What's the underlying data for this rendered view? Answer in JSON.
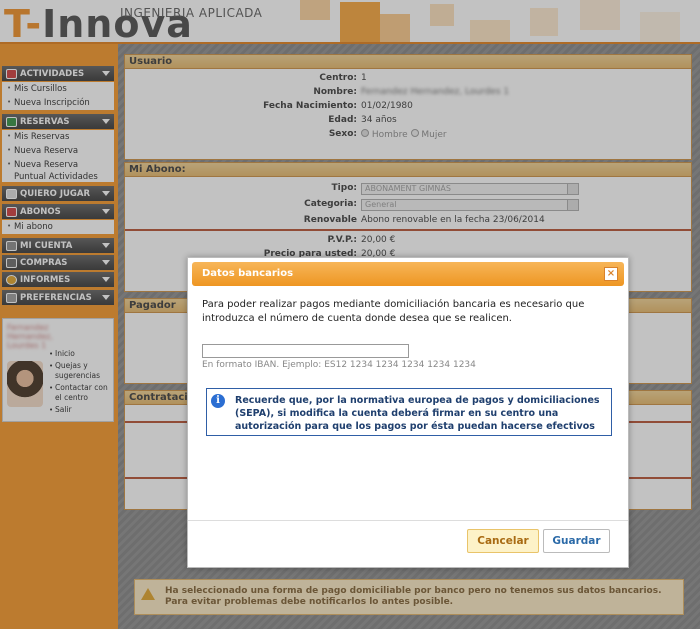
{
  "header": {
    "brand_prefix": "T-",
    "brand_main": "Innova",
    "tagline": "INGENIERIA APLICADA"
  },
  "sidebar": {
    "sections": [
      {
        "label": "ACTIVIDADES",
        "items": [
          "Mis Cursillos",
          "Nueva Inscripción"
        ]
      },
      {
        "label": "RESERVAS",
        "items": [
          "Mis Reservas",
          "Nueva Reserva",
          "Nueva Reserva Puntual Actividades"
        ]
      },
      {
        "label": "QUIERO JUGAR",
        "items": []
      },
      {
        "label": "ABONOS",
        "items": [
          "Mi abono"
        ]
      },
      {
        "label": "MI CUENTA",
        "items": []
      },
      {
        "label": "COMPRAS",
        "items": []
      },
      {
        "label": "INFORMES",
        "items": []
      },
      {
        "label": "PREFERENCIAS",
        "items": []
      }
    ],
    "user_links": [
      "Inicio",
      "Quejas y sugerencias",
      "Contactar con el centro",
      "Salir"
    ]
  },
  "usuario": {
    "title": "Usuario",
    "centro_label": "Centro:",
    "centro": "1",
    "nombre_label": "Nombre:",
    "nombre": "Fernandez Hernandez, Lourdes 1",
    "nac_label": "Fecha Nacimiento:",
    "nac": "01/02/1980",
    "edad_label": "Edad:",
    "edad": "34 años",
    "sexo_label": "Sexo:",
    "sexo_opt1": "Hombre",
    "sexo_opt2": "Mujer"
  },
  "abono": {
    "title": "Mi Abono:",
    "tipo_label": "Tipo:",
    "tipo": "ABONAMENT GIMNÀS",
    "categoria_label": "Categoria:",
    "categoria": "General",
    "renovable_label": "Renovable",
    "renovable": "Abono renovable en la fecha 23/06/2014",
    "pvp_label": "P.V.P.:",
    "pvp": "20,00 €",
    "precio_label": "Precio para usted:",
    "precio": "20,00 €"
  },
  "pagador": {
    "title": "Pagador"
  },
  "contratacion": {
    "title": "Contratación"
  },
  "warning": {
    "text": "Ha seleccionado una forma de pago domiciliable por banco pero no tenemos sus datos bancarios. Para evitar problemas debe notificarlos lo antes posible."
  },
  "modal": {
    "title": "Datos bancarios",
    "close": "×",
    "message": "Para poder realizar pagos mediante domiciliación bancaria es necesario que introduzca el número de cuenta donde desea que se realicen.",
    "iban_value": "",
    "iban_hint": "En formato IBAN. Ejemplo: ES12 1234 1234 1234 1234 1234",
    "info_icon": "i",
    "info": "Recuerde que, por la normativa europea de pagos y domiciliaciones (SEPA), si modifica la cuenta deberá firmar en su centro una autorización para que los pagos por ésta puedan hacerse efectivos",
    "cancel": "Cancelar",
    "save": "Guardar"
  }
}
